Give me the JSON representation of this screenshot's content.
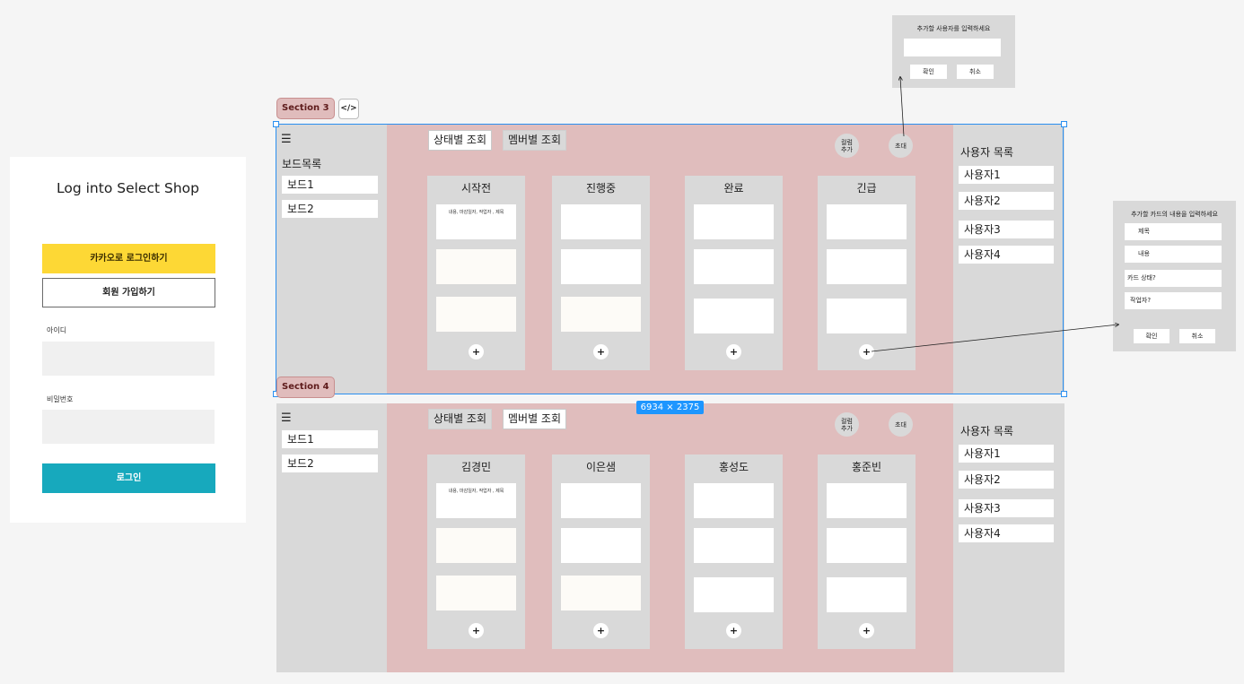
{
  "login": {
    "title": "Log into Select Shop",
    "kakao_button": "카카오로 로그인하기",
    "signup_button": "회원 가입하기",
    "id_label": "아이디",
    "password_label": "비밀번호",
    "login_button": "로그인"
  },
  "section3": {
    "tag": "Section 3",
    "code_icon": "</>",
    "menu_icon": "☰",
    "board_list_title": "보드목록",
    "boards": [
      "보드1",
      "보드2"
    ],
    "view_tabs": [
      "상태별 조회",
      "멤버별 조회"
    ],
    "active_tab": "상태별 조회",
    "add_column": "컬럼\n추가",
    "invite": "초대",
    "columns": [
      "시작전",
      "진행중",
      "완료",
      "긴급"
    ],
    "card_hint": "내용, 마감일자, 작업자 , 제목",
    "add_symbol": "+",
    "user_list_title": "사용자 목록",
    "users": [
      "사용자1",
      "사용자2",
      "사용자3",
      "사용자4"
    ]
  },
  "section4": {
    "tag": "Section 4",
    "menu_icon": "☰",
    "boards": [
      "보드1",
      "보드2"
    ],
    "view_tabs": [
      "상태별 조회",
      "멤버별 조회"
    ],
    "active_tab": "멤버별 조회",
    "add_column": "컬럼\n추가",
    "invite": "초대",
    "columns": [
      "김경민",
      "이은샘",
      "홍성도",
      "홍준빈"
    ],
    "card_hint": "내용, 마감일자, 작업자 , 제목",
    "add_symbol": "+",
    "user_list_title": "사용자 목록",
    "users": [
      "사용자1",
      "사용자2",
      "사용자3",
      "사용자4"
    ]
  },
  "selection_dimensions": "6934 × 2375",
  "invite_popup": {
    "title": "추가할 사용자를 입력하세요",
    "confirm": "확인",
    "cancel": "취소"
  },
  "card_popup": {
    "title": "추가할 카드의 내용을 입력하세요",
    "fields": [
      "제목",
      "내용",
      "카드 상태?",
      "작업자?"
    ],
    "confirm": "확인",
    "cancel": "취소"
  },
  "colors": {
    "kakao": "#fdd835",
    "login": "#17a9bd",
    "section_bg": "#e0bdbd",
    "panel": "#d9d9d9",
    "selection": "#2a8ff0"
  }
}
